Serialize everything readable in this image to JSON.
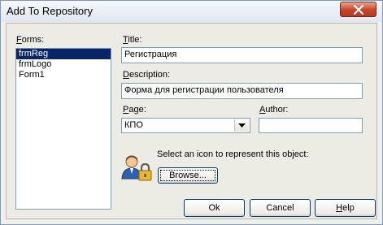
{
  "window": {
    "title": "Add To Repository"
  },
  "forms": {
    "label": "Forms:",
    "items": [
      "frmReg",
      "frmLogo",
      "Form1"
    ],
    "selected": "frmReg"
  },
  "title_field": {
    "label": "Title:",
    "value": "Регистрация"
  },
  "description_field": {
    "label": "Description:",
    "value": "Форма для регистрации пользователя"
  },
  "page_field": {
    "label": "Page:",
    "value": "КПО"
  },
  "author_field": {
    "label": "Author:",
    "value": ""
  },
  "icon_prompt": "Select an icon to represent this object:",
  "buttons": {
    "browse": "Browse...",
    "ok": "Ok",
    "cancel": "Cancel",
    "help": "Help"
  },
  "colors": {
    "selection": "#0a246a",
    "field_border": "#7f9db9",
    "close_button": "#c4452a"
  },
  "icons": {
    "close": "close-icon",
    "object_icon": "user-lock-icon",
    "dropdown": "chevron-down-icon"
  }
}
